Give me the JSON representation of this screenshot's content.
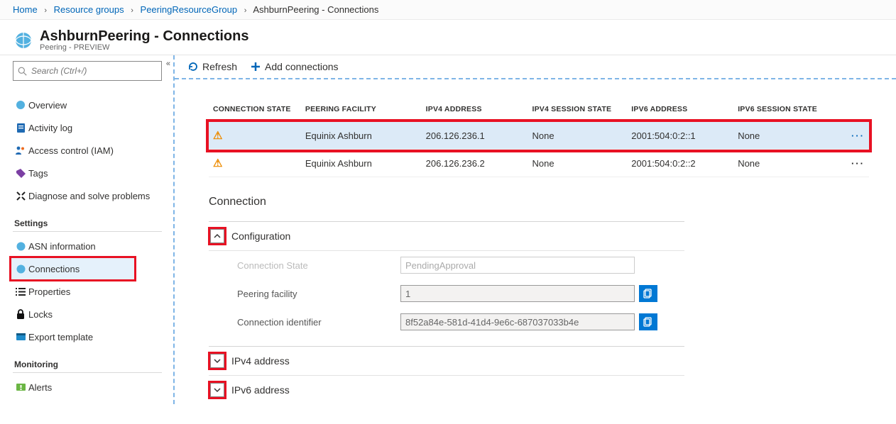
{
  "breadcrumb": {
    "home": "Home",
    "rg": "Resource groups",
    "group": "PeeringResourceGroup",
    "current": "AshburnPeering - Connections"
  },
  "header": {
    "title": "AshburnPeering - Connections",
    "subtitle": "Peering - PREVIEW"
  },
  "search": {
    "placeholder": "Search (Ctrl+/)"
  },
  "nav": {
    "overview": "Overview",
    "activity": "Activity log",
    "iam": "Access control (IAM)",
    "tags": "Tags",
    "diagnose": "Diagnose and solve problems",
    "settings_heading": "Settings",
    "asn": "ASN information",
    "connections": "Connections",
    "properties": "Properties",
    "locks": "Locks",
    "export": "Export template",
    "monitoring_heading": "Monitoring",
    "alerts": "Alerts"
  },
  "toolbar": {
    "refresh": "Refresh",
    "add": "Add connections"
  },
  "table": {
    "headers": {
      "state": "CONNECTION STATE",
      "facility": "PEERING FACILITY",
      "ipv4": "IPV4 ADDRESS",
      "ipv4s": "IPV4 SESSION STATE",
      "ipv6": "IPV6 ADDRESS",
      "ipv6s": "IPV6 SESSION STATE"
    },
    "rows": [
      {
        "facility": "Equinix Ashburn",
        "ipv4": "206.126.236.1",
        "ipv4s": "None",
        "ipv6": "2001:504:0:2::1",
        "ipv6s": "None"
      },
      {
        "facility": "Equinix Ashburn",
        "ipv4": "206.126.236.2",
        "ipv4s": "None",
        "ipv6": "2001:504:0:2::2",
        "ipv6s": "None"
      }
    ]
  },
  "section_title": "Connection",
  "config": {
    "heading": "Configuration",
    "state_label": "Connection State",
    "state_value": "PendingApproval",
    "facility_label": "Peering facility",
    "facility_value": "1",
    "id_label": "Connection identifier",
    "id_value": "8f52a84e-581d-41d4-9e6c-687037033b4e"
  },
  "ipv4_section": "IPv4 address",
  "ipv6_section": "IPv6 address"
}
